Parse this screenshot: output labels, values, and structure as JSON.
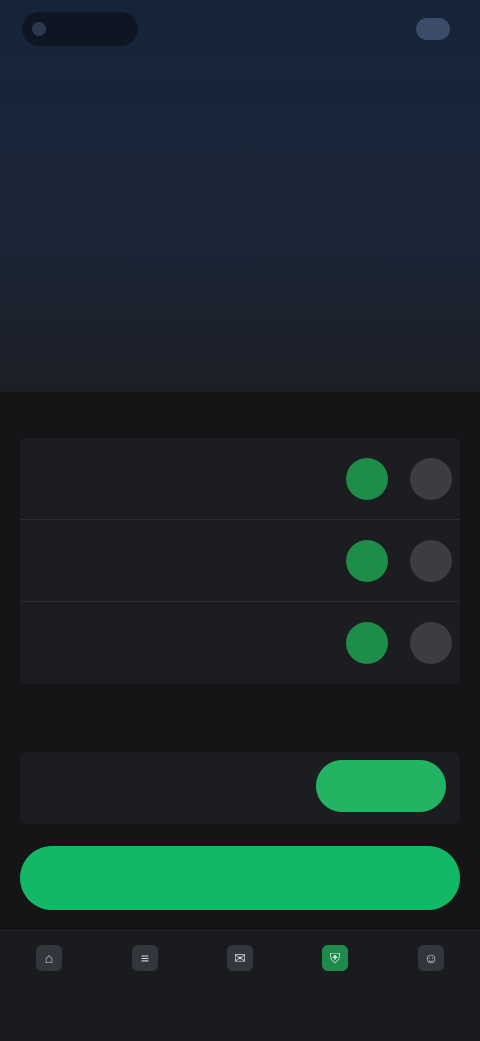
{
  "topbar": {
    "brand": "",
    "right_text": "",
    "right_button": ""
  },
  "hero": {
    "title": "",
    "lines": [
      "",
      "",
      "",
      "",
      ""
    ]
  },
  "settings": {
    "section_title": "",
    "rows": [
      {
        "name": "",
        "sub": "",
        "on_label": "",
        "off_label": ""
      },
      {
        "name": "",
        "sub": "",
        "on_label": "",
        "off_label": ""
      },
      {
        "name": "",
        "sub": "",
        "on_label": "",
        "off_label": ""
      }
    ]
  },
  "backup": {
    "section_title": "",
    "title": "",
    "sub": "",
    "button_label": ""
  },
  "primary_button": "",
  "bottom_nav": [
    {
      "label": "",
      "icon": "home-icon"
    },
    {
      "label": "",
      "icon": "list-icon"
    },
    {
      "label": "",
      "icon": "chat-icon"
    },
    {
      "label": "",
      "icon": "shield-icon",
      "active": true
    },
    {
      "label": "",
      "icon": "user-icon"
    }
  ],
  "colors": {
    "accent": "#12b865",
    "toggle_on": "#1e8d4a",
    "toggle_off": "#3c3d42",
    "background": "#141517",
    "hero_top": "#16243a"
  }
}
